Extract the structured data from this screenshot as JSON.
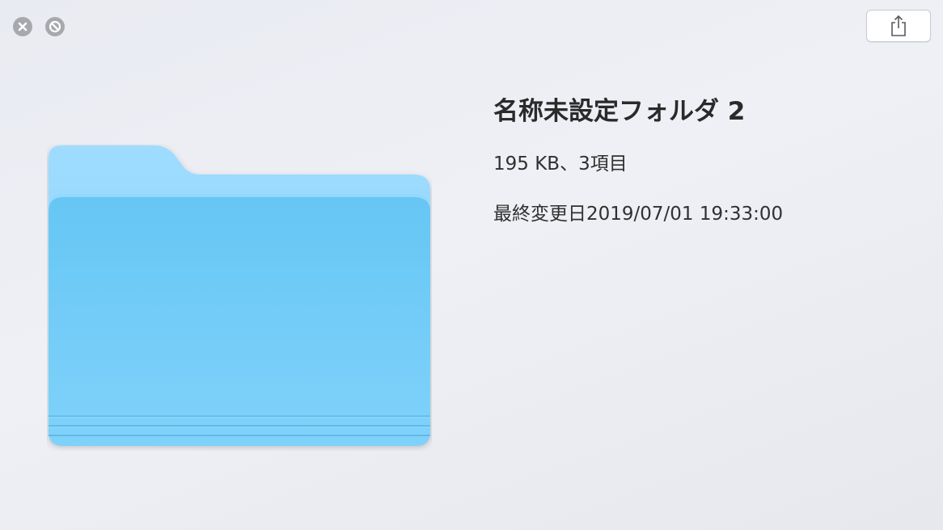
{
  "window": {
    "close_icon": "close-icon",
    "fullscreen_icon": "fullscreen-icon"
  },
  "toolbar": {
    "share_icon": "share-icon"
  },
  "preview": {
    "icon": "folder-icon",
    "folder_color": "#6ec9f5"
  },
  "info": {
    "name": "名称未設定フォルダ 2",
    "size_summary": "195 KB、3項目",
    "modified": "最終変更日2019/07/01 19:33:00"
  }
}
